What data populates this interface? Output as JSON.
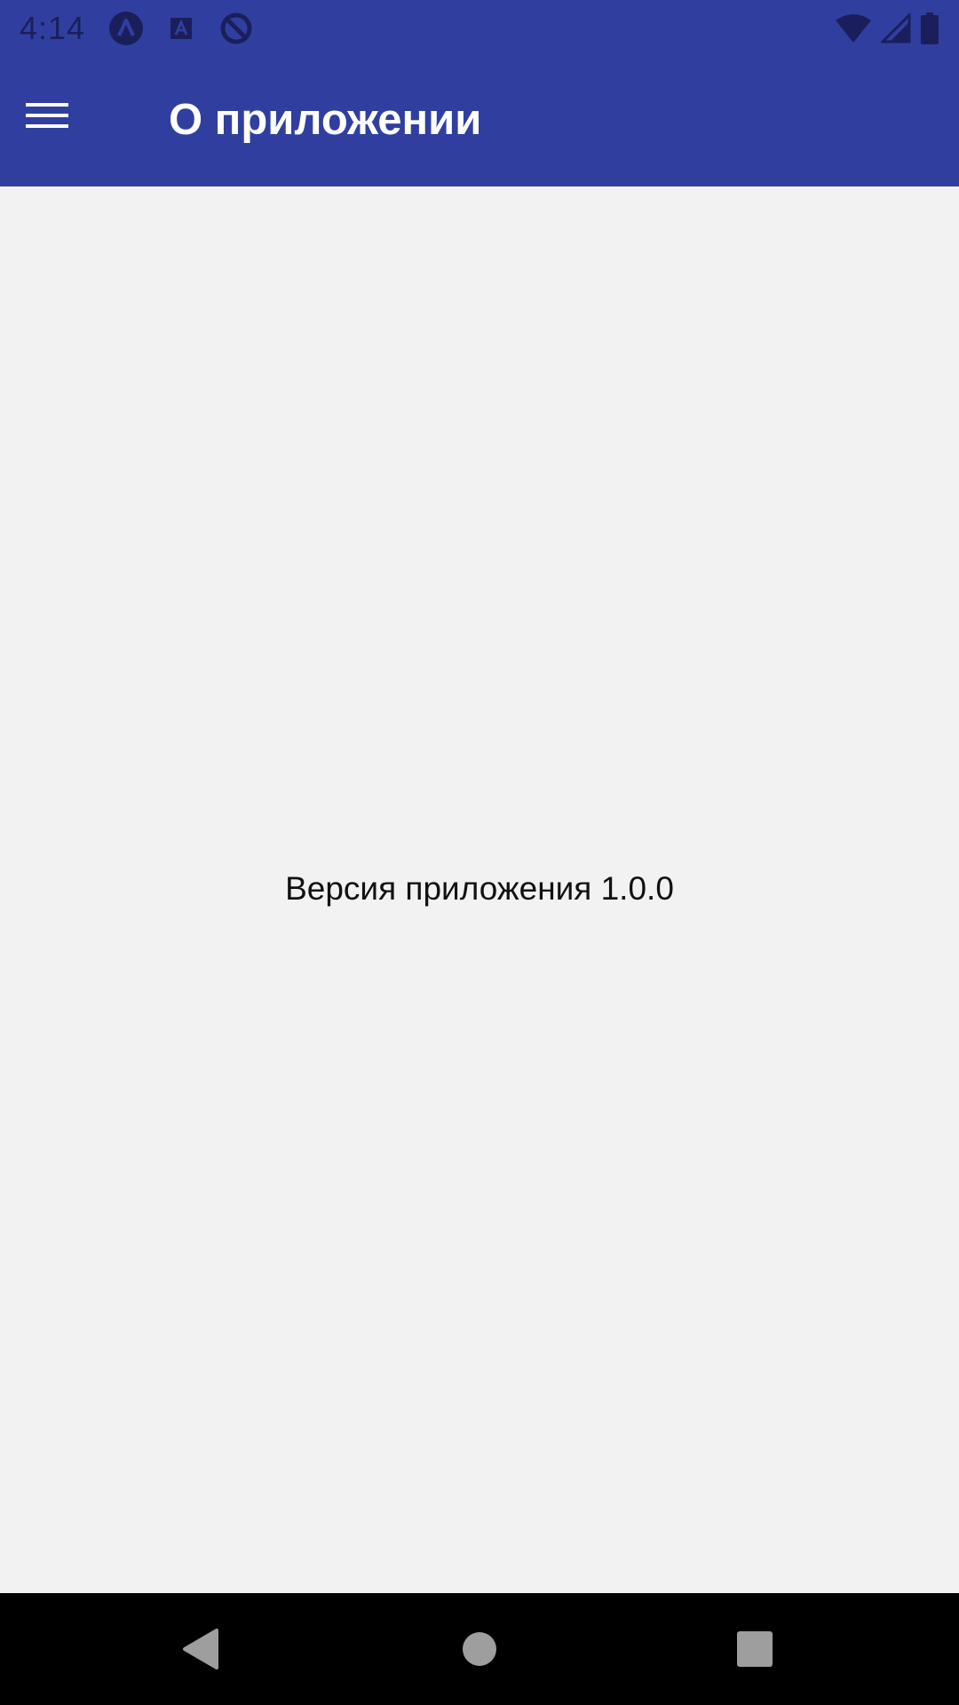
{
  "status_bar": {
    "time": "4:14",
    "notification_icons": [
      "app-a-circle-icon",
      "app-a-square-icon",
      "no-sync-icon"
    ],
    "system_icons": [
      "wifi-icon",
      "cell-signal-icon",
      "battery-icon"
    ]
  },
  "app_bar": {
    "title": "О приложении",
    "menu_icon": "hamburger-menu-icon"
  },
  "content": {
    "version_text": "Версия приложения 1.0.0"
  },
  "nav_bar": {
    "buttons": [
      "back-icon",
      "home-icon",
      "recents-icon"
    ]
  },
  "colors": {
    "primary": "#303f9f",
    "background": "#f2f2f2",
    "status_icon": "#1a1f5c",
    "nav_icon": "#9e9e9e"
  }
}
